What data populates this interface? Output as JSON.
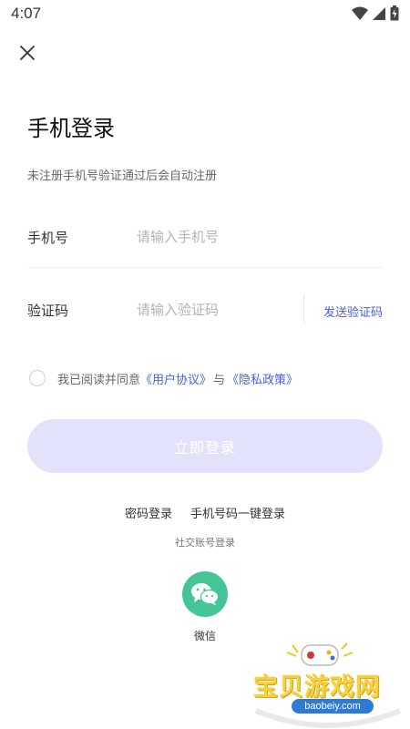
{
  "status_bar": {
    "time": "4:07",
    "icons": [
      "wifi-icon",
      "signal-icon",
      "battery-icon"
    ]
  },
  "header": {
    "close_icon": "close-icon"
  },
  "title": "手机登录",
  "subtitle": "未注册手机号验证通过后会自动注册",
  "phone_field": {
    "label": "手机号",
    "placeholder": "请输入手机号",
    "value": ""
  },
  "code_field": {
    "label": "验证码",
    "placeholder": "请输入验证码",
    "value": "",
    "send_button": "发送验证码"
  },
  "agreement": {
    "checked": false,
    "prefix": "我已阅读并同意",
    "user_agreement": "《用户协议》",
    "joiner": "与",
    "privacy_policy": "《隐私政策》"
  },
  "login_button": "立即登录",
  "alt_logins": {
    "password_login": "密码登录",
    "one_click_login": "手机号码一键登录"
  },
  "social": {
    "title": "社交账号登录",
    "wechat_label": "微信",
    "wechat_icon": "wechat-icon"
  },
  "watermark": {
    "text": "宝贝游戏网",
    "url": "baobeiy.com"
  },
  "colors": {
    "accent": "#4c5ee0",
    "login_button_bg": "#e2e3fb",
    "wechat": "#45c596"
  }
}
